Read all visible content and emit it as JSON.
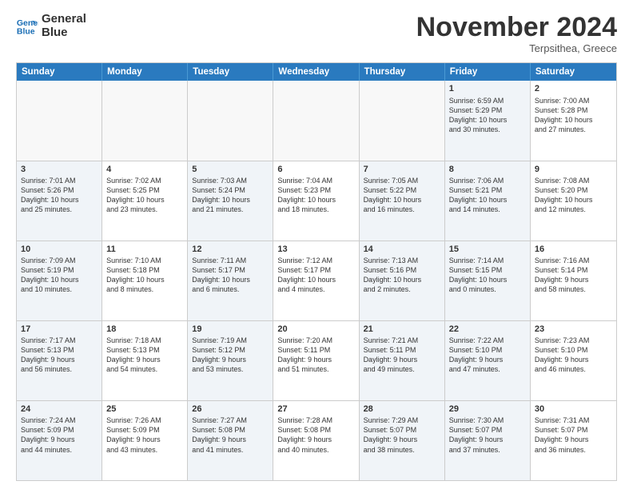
{
  "header": {
    "logo_line1": "General",
    "logo_line2": "Blue",
    "month": "November 2024",
    "location": "Terpsithea, Greece"
  },
  "weekdays": [
    "Sunday",
    "Monday",
    "Tuesday",
    "Wednesday",
    "Thursday",
    "Friday",
    "Saturday"
  ],
  "rows": [
    [
      {
        "day": "",
        "info": "",
        "empty": true
      },
      {
        "day": "",
        "info": "",
        "empty": true
      },
      {
        "day": "",
        "info": "",
        "empty": true
      },
      {
        "day": "",
        "info": "",
        "empty": true
      },
      {
        "day": "",
        "info": "",
        "empty": true
      },
      {
        "day": "1",
        "info": "Sunrise: 6:59 AM\nSunset: 5:29 PM\nDaylight: 10 hours\nand 30 minutes.",
        "shaded": true
      },
      {
        "day": "2",
        "info": "Sunrise: 7:00 AM\nSunset: 5:28 PM\nDaylight: 10 hours\nand 27 minutes."
      }
    ],
    [
      {
        "day": "3",
        "info": "Sunrise: 7:01 AM\nSunset: 5:26 PM\nDaylight: 10 hours\nand 25 minutes.",
        "shaded": true
      },
      {
        "day": "4",
        "info": "Sunrise: 7:02 AM\nSunset: 5:25 PM\nDaylight: 10 hours\nand 23 minutes."
      },
      {
        "day": "5",
        "info": "Sunrise: 7:03 AM\nSunset: 5:24 PM\nDaylight: 10 hours\nand 21 minutes.",
        "shaded": true
      },
      {
        "day": "6",
        "info": "Sunrise: 7:04 AM\nSunset: 5:23 PM\nDaylight: 10 hours\nand 18 minutes."
      },
      {
        "day": "7",
        "info": "Sunrise: 7:05 AM\nSunset: 5:22 PM\nDaylight: 10 hours\nand 16 minutes.",
        "shaded": true
      },
      {
        "day": "8",
        "info": "Sunrise: 7:06 AM\nSunset: 5:21 PM\nDaylight: 10 hours\nand 14 minutes.",
        "shaded": true
      },
      {
        "day": "9",
        "info": "Sunrise: 7:08 AM\nSunset: 5:20 PM\nDaylight: 10 hours\nand 12 minutes."
      }
    ],
    [
      {
        "day": "10",
        "info": "Sunrise: 7:09 AM\nSunset: 5:19 PM\nDaylight: 10 hours\nand 10 minutes.",
        "shaded": true
      },
      {
        "day": "11",
        "info": "Sunrise: 7:10 AM\nSunset: 5:18 PM\nDaylight: 10 hours\nand 8 minutes."
      },
      {
        "day": "12",
        "info": "Sunrise: 7:11 AM\nSunset: 5:17 PM\nDaylight: 10 hours\nand 6 minutes.",
        "shaded": true
      },
      {
        "day": "13",
        "info": "Sunrise: 7:12 AM\nSunset: 5:17 PM\nDaylight: 10 hours\nand 4 minutes."
      },
      {
        "day": "14",
        "info": "Sunrise: 7:13 AM\nSunset: 5:16 PM\nDaylight: 10 hours\nand 2 minutes.",
        "shaded": true
      },
      {
        "day": "15",
        "info": "Sunrise: 7:14 AM\nSunset: 5:15 PM\nDaylight: 10 hours\nand 0 minutes.",
        "shaded": true
      },
      {
        "day": "16",
        "info": "Sunrise: 7:16 AM\nSunset: 5:14 PM\nDaylight: 9 hours\nand 58 minutes."
      }
    ],
    [
      {
        "day": "17",
        "info": "Sunrise: 7:17 AM\nSunset: 5:13 PM\nDaylight: 9 hours\nand 56 minutes.",
        "shaded": true
      },
      {
        "day": "18",
        "info": "Sunrise: 7:18 AM\nSunset: 5:13 PM\nDaylight: 9 hours\nand 54 minutes."
      },
      {
        "day": "19",
        "info": "Sunrise: 7:19 AM\nSunset: 5:12 PM\nDaylight: 9 hours\nand 53 minutes.",
        "shaded": true
      },
      {
        "day": "20",
        "info": "Sunrise: 7:20 AM\nSunset: 5:11 PM\nDaylight: 9 hours\nand 51 minutes."
      },
      {
        "day": "21",
        "info": "Sunrise: 7:21 AM\nSunset: 5:11 PM\nDaylight: 9 hours\nand 49 minutes.",
        "shaded": true
      },
      {
        "day": "22",
        "info": "Sunrise: 7:22 AM\nSunset: 5:10 PM\nDaylight: 9 hours\nand 47 minutes.",
        "shaded": true
      },
      {
        "day": "23",
        "info": "Sunrise: 7:23 AM\nSunset: 5:10 PM\nDaylight: 9 hours\nand 46 minutes."
      }
    ],
    [
      {
        "day": "24",
        "info": "Sunrise: 7:24 AM\nSunset: 5:09 PM\nDaylight: 9 hours\nand 44 minutes.",
        "shaded": true
      },
      {
        "day": "25",
        "info": "Sunrise: 7:26 AM\nSunset: 5:09 PM\nDaylight: 9 hours\nand 43 minutes."
      },
      {
        "day": "26",
        "info": "Sunrise: 7:27 AM\nSunset: 5:08 PM\nDaylight: 9 hours\nand 41 minutes.",
        "shaded": true
      },
      {
        "day": "27",
        "info": "Sunrise: 7:28 AM\nSunset: 5:08 PM\nDaylight: 9 hours\nand 40 minutes."
      },
      {
        "day": "28",
        "info": "Sunrise: 7:29 AM\nSunset: 5:07 PM\nDaylight: 9 hours\nand 38 minutes.",
        "shaded": true
      },
      {
        "day": "29",
        "info": "Sunrise: 7:30 AM\nSunset: 5:07 PM\nDaylight: 9 hours\nand 37 minutes.",
        "shaded": true
      },
      {
        "day": "30",
        "info": "Sunrise: 7:31 AM\nSunset: 5:07 PM\nDaylight: 9 hours\nand 36 minutes."
      }
    ]
  ]
}
